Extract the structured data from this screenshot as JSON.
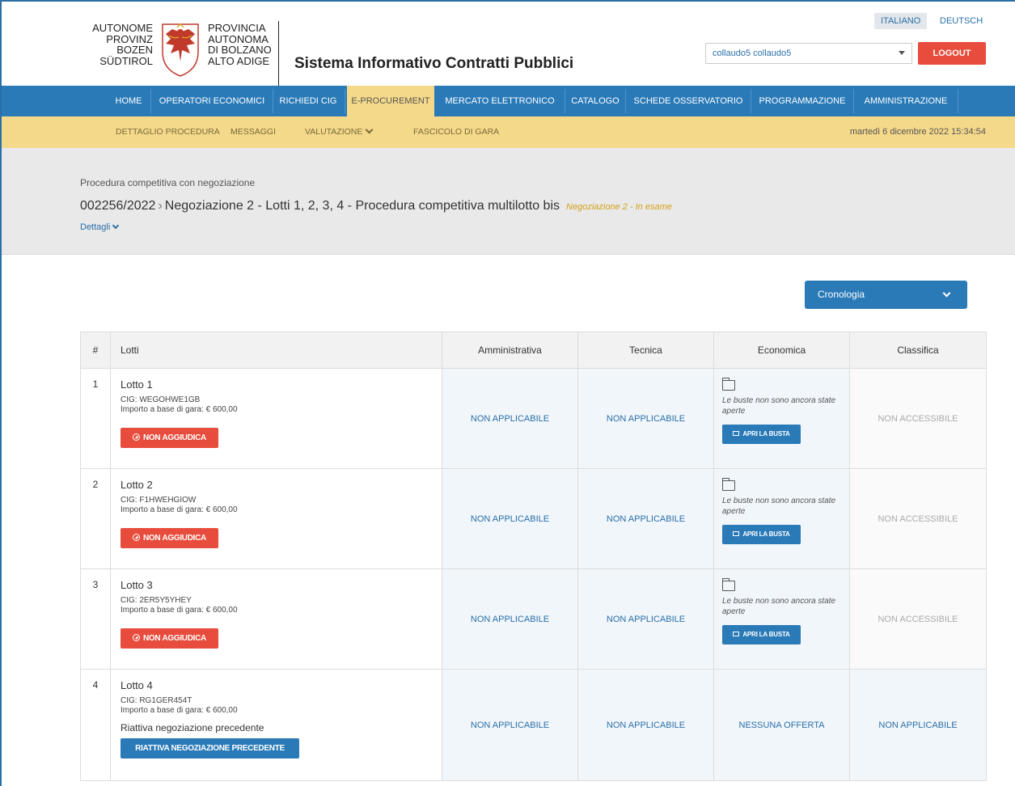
{
  "header": {
    "logo_left_lines": [
      "AUTONOME",
      "PROVINZ",
      "BOZEN",
      "SÜDTIROL"
    ],
    "logo_right_lines": [
      "PROVINCIA",
      "AUTONOMA",
      "DI BOLZANO",
      "ALTO ADIGE"
    ],
    "system_title": "Sistema Informativo Contratti Pubblici",
    "lang_it": "ITALIANO",
    "lang_de": "DEUTSCH",
    "user": "collaudo5 collaudo5",
    "logout": "LOGOUT"
  },
  "nav": {
    "items": [
      "HOME",
      "OPERATORI ECONOMICI",
      "RICHIEDI CIG",
      "E-PROCUREMENT",
      "MERCATO ELETTRONICO",
      "CATALOGO",
      "SCHEDE OSSERVATORIO",
      "PROGRAMMAZIONE",
      "AMMINISTRAZIONE"
    ],
    "active": "E-PROCUREMENT"
  },
  "subnav": {
    "items": [
      "DETTAGLIO PROCEDURA",
      "MESSAGGI",
      "VALUTAZIONE",
      "FASCICOLO DI GARA"
    ],
    "datetime": "martedì 6 dicembre 2022 15:34:54"
  },
  "procedure": {
    "type": "Procedura competitiva con negoziazione",
    "code": "002256/2022",
    "title": "Negoziazione 2 - Lotti 1, 2, 3, 4 - Procedura competitiva multilotto bis",
    "status": "Negoziazione 2 - In esame",
    "details_label": "Dettagli"
  },
  "cronologia_label": "Cronologia",
  "table": {
    "headers": [
      "#",
      "Lotti",
      "Amministrativa",
      "Tecnica",
      "Economica",
      "Classifica"
    ],
    "rows": [
      {
        "num": "1",
        "name": "Lotto 1",
        "cig": "CIG: WEGOHWE1GB",
        "importo": "Importo a base di gara: € 600,00",
        "action": "NON AGGIUDICA",
        "amministrativa": "NON APPLICABILE",
        "tecnica": "NON APPLICABILE",
        "economica_msg": "Le buste non sono ancora state aperte",
        "economica_btn": "APRI LA BUSTA",
        "classifica": "NON ACCESSIBILE"
      },
      {
        "num": "2",
        "name": "Lotto 2",
        "cig": "CIG: F1HWEHGIOW",
        "importo": "Importo a base di gara: € 600,00",
        "action": "NON AGGIUDICA",
        "amministrativa": "NON APPLICABILE",
        "tecnica": "NON APPLICABILE",
        "economica_msg": "Le buste non sono ancora state aperte",
        "economica_btn": "APRI LA BUSTA",
        "classifica": "NON ACCESSIBILE"
      },
      {
        "num": "3",
        "name": "Lotto 3",
        "cig": "CIG: 2ER5Y5YHEY",
        "importo": "Importo a base di gara: € 600,00",
        "action": "NON AGGIUDICA",
        "amministrativa": "NON APPLICABILE",
        "tecnica": "NON APPLICABILE",
        "economica_msg": "Le buste non sono ancora state aperte",
        "economica_btn": "APRI LA BUSTA",
        "classifica": "NON ACCESSIBILE"
      },
      {
        "num": "4",
        "name": "Lotto 4",
        "cig": "CIG: RG1GER454T",
        "importo": "Importo a base di gara: € 600,00",
        "riattiva_text": "Riattiva negoziazione precedente",
        "riattiva_btn": "RIATTIVA NEGOZIAZIONE PRECEDENTE",
        "amministrativa": "NON APPLICABILE",
        "tecnica": "NON APPLICABILE",
        "economica": "NESSUNA OFFERTA",
        "classifica": "NON APPLICABILE"
      }
    ]
  },
  "colors": {
    "primary_blue": "#2a7ab8",
    "danger_red": "#e74c3c",
    "subnav_yellow": "#f5d98a",
    "status_gold": "#d4a017"
  }
}
